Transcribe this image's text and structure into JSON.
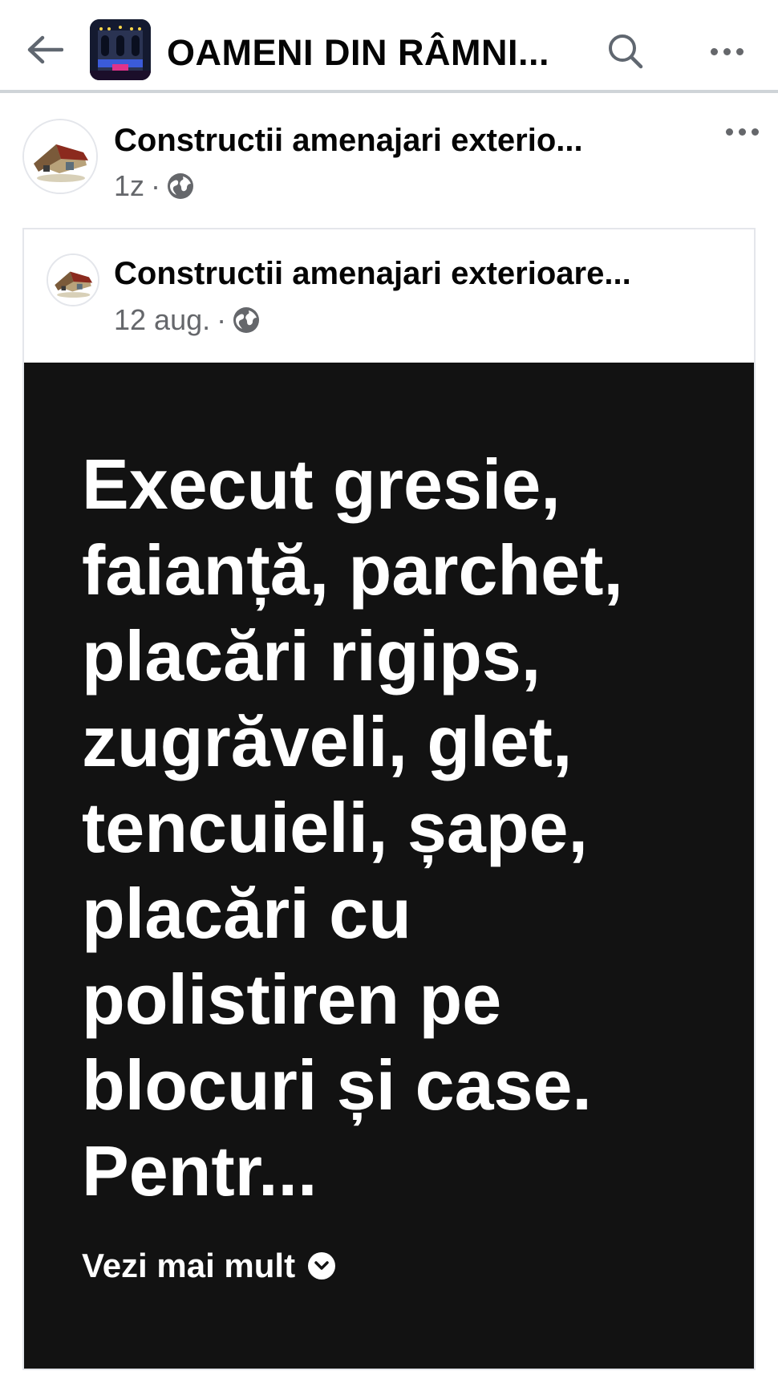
{
  "header": {
    "group_title": "OAMENI DIN RÂMNI...",
    "back_icon": "arrow-left-icon",
    "search_icon": "search-icon",
    "more_icon": "more-horizontal-icon"
  },
  "post": {
    "author": "Constructii amenajari exterio...",
    "time": "1z",
    "separator": "·",
    "privacy_icon": "globe-icon",
    "shared": {
      "author": "Constructii amenajari exterioare...",
      "time": "12 aug.",
      "separator": "·",
      "privacy_icon": "globe-icon",
      "text": "Execut gresie,\nfaianță, parchet,\nplacări rigips,\nzugrăveli, glet,\ntencuieli, șape,\nplacări cu\npolistiren pe\nblocuri și case.\nPentr...",
      "see_more": "Vezi mai mult",
      "see_more_icon": "chevron-down-circle-icon",
      "background_color": "#121212"
    }
  }
}
